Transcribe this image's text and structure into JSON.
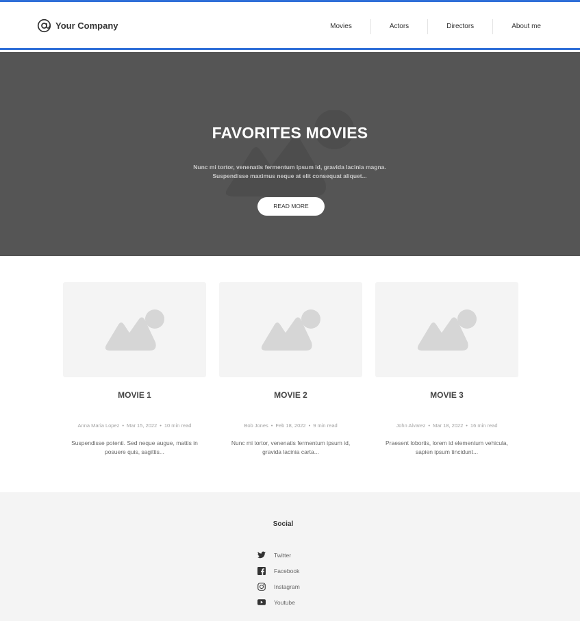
{
  "brand": {
    "name": "Your Company",
    "icon": "at-sign-icon",
    "accent": "#2f6fd8"
  },
  "nav": {
    "items": [
      {
        "label": "Movies"
      },
      {
        "label": "Actors"
      },
      {
        "label": "Directors"
      },
      {
        "label": "About me"
      }
    ]
  },
  "hero": {
    "title": "FAVORITES MOVIES",
    "subtitle_line1": "Nunc mi tortor, venenatis fermentum ipsum id, gravida lacinia magna.",
    "subtitle_line2": "Suspendisse maximus neque at elit consequat aliquet...",
    "button": "READ MORE",
    "background": "#555555"
  },
  "cards": [
    {
      "title": "MOVIE 1",
      "author": "Anna Maria Lopez",
      "date": "Mar 15, 2022",
      "read": "10 min read",
      "excerpt_line1": "Suspendisse potenti. Sed neque augue, mattis in",
      "excerpt_line2": "posuere quis, sagittis..."
    },
    {
      "title": "MOVIE 2",
      "author": "Bob Jones",
      "date": "Feb 18, 2022",
      "read": "9 min read",
      "excerpt_line1": "Nunc mi tortor, venenatis fermentum ipsum id,",
      "excerpt_line2": "gravida lacinia carta..."
    },
    {
      "title": "MOVIE 3",
      "author": "John Alvarez",
      "date": "Mar 18, 2022",
      "read": "16 min read",
      "excerpt_line1": "Praesent lobortis, lorem id elementum vehicula,",
      "excerpt_line2": "sapien ipsum tincidunt..."
    }
  ],
  "footer": {
    "social_title": "Social",
    "links": [
      {
        "label": "Twitter",
        "icon": "twitter-icon"
      },
      {
        "label": "Facebook",
        "icon": "facebook-icon"
      },
      {
        "label": "Instagram",
        "icon": "instagram-icon"
      },
      {
        "label": "Youtube",
        "icon": "youtube-icon"
      }
    ]
  }
}
